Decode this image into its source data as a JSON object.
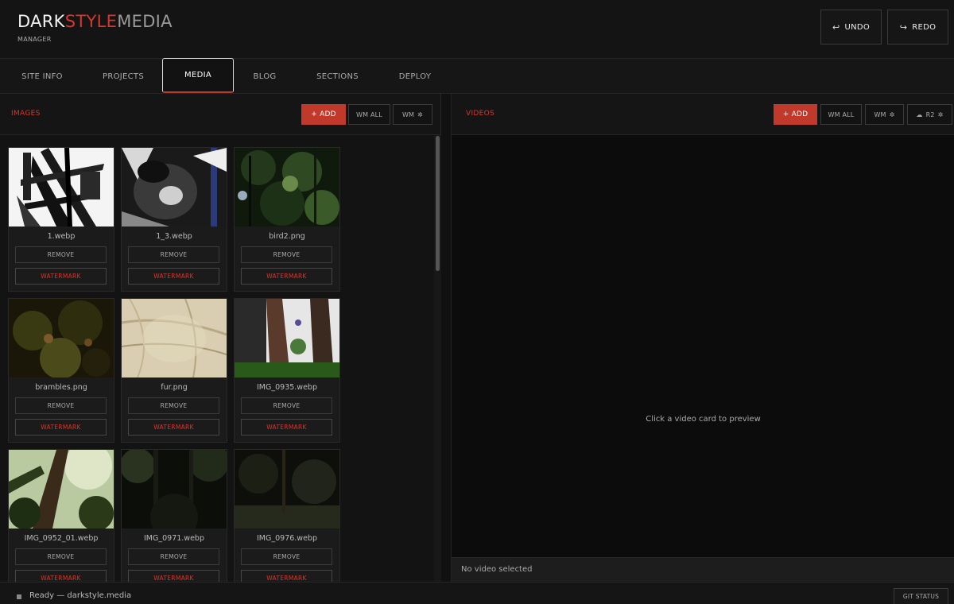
{
  "header": {
    "logo_part1": "DARK",
    "logo_part2": "STYLE",
    "logo_part3": "MEDIA",
    "subtitle": "MANAGER",
    "undo_label": "UNDO",
    "redo_label": "REDO",
    "undo_icon": "↩",
    "redo_icon": "↪"
  },
  "tabs": [
    {
      "label": "SITE INFO",
      "active": false
    },
    {
      "label": "PROJECTS",
      "active": false
    },
    {
      "label": "MEDIA",
      "active": true
    },
    {
      "label": "BLOG",
      "active": false
    },
    {
      "label": "SECTIONS",
      "active": false
    },
    {
      "label": "DEPLOY",
      "active": false
    }
  ],
  "images": {
    "title": "IMAGES",
    "add_label": "+ ADD",
    "wm_all_label": "WM ALL",
    "wm_label": "WM",
    "gear_icon": "✲",
    "remove_label": "REMOVE",
    "watermark_label": "WATERMARK",
    "items": [
      {
        "name": "1.webp"
      },
      {
        "name": "1_3.webp"
      },
      {
        "name": "bird2.png"
      },
      {
        "name": "brambles.png"
      },
      {
        "name": "fur.png"
      },
      {
        "name": "IMG_0935.webp"
      },
      {
        "name": "IMG_0952_01.webp"
      },
      {
        "name": "IMG_0971.webp"
      },
      {
        "name": "IMG_0976.webp"
      }
    ]
  },
  "videos": {
    "title": "VIDEOS",
    "add_label": "+ ADD",
    "wm_all_label": "WM ALL",
    "wm_label": "WM",
    "r2_label": "R2",
    "cloud_icon": "☁",
    "gear_icon": "✲",
    "preview_hint": "Click a video card to preview",
    "footer_text": "No video selected"
  },
  "status": {
    "text": "Ready — darkstyle.media",
    "git_label": "GIT STATUS"
  },
  "colors": {
    "accent": "#d6372c",
    "background": "#111111"
  }
}
